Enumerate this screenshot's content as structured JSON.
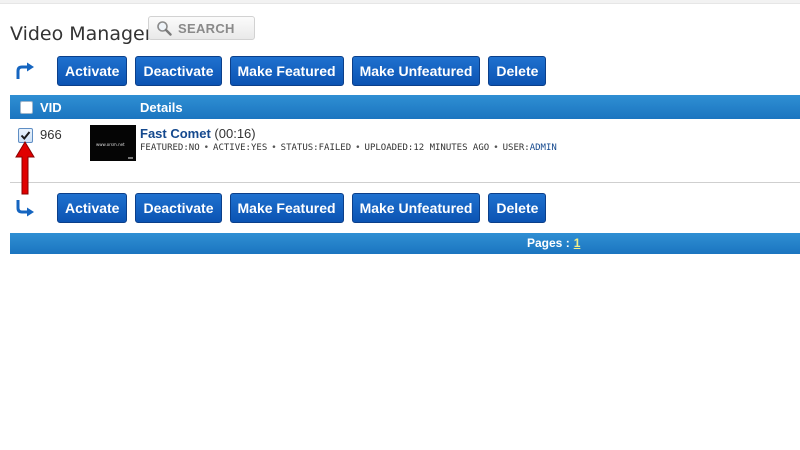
{
  "header": {
    "title": "Video Manager",
    "search_label": "SEARCH"
  },
  "actions": {
    "activate": "Activate",
    "deactivate": "Deactivate",
    "make_featured": "Make Featured",
    "make_unfeatured": "Make Unfeatured",
    "delete": "Delete"
  },
  "table": {
    "columns": {
      "vid": "VID",
      "details": "Details"
    },
    "rows": [
      {
        "checked": true,
        "vid": "966",
        "thumbnail_text": "www.orsm.net",
        "title": "Fast Comet",
        "duration": "(00:16)",
        "meta": {
          "featured_label": "FEATURED:",
          "featured": "NO",
          "active_label": "ACTIVE:",
          "active": "YES",
          "status_label": "STATUS:",
          "status": "FAILED",
          "uploaded_label": "UPLOADED:",
          "uploaded": "12 MINUTES AGO",
          "user_label": "USER:",
          "user": "ADMIN",
          "separator": "•"
        }
      }
    ]
  },
  "pagination": {
    "label": "Pages :",
    "pages": [
      "1"
    ]
  },
  "colors": {
    "button": "#0b53b3",
    "header_bar": "#1b75c0",
    "link": "#15498e",
    "page_link": "#f3f08a",
    "annotation_arrow": "#e00000"
  },
  "icons": {
    "search": "magnifier-icon",
    "bulk_top": "arrow-turn-right-icon",
    "bulk_bottom": "arrow-turn-down-right-icon",
    "annotation": "red-up-arrow-icon"
  }
}
